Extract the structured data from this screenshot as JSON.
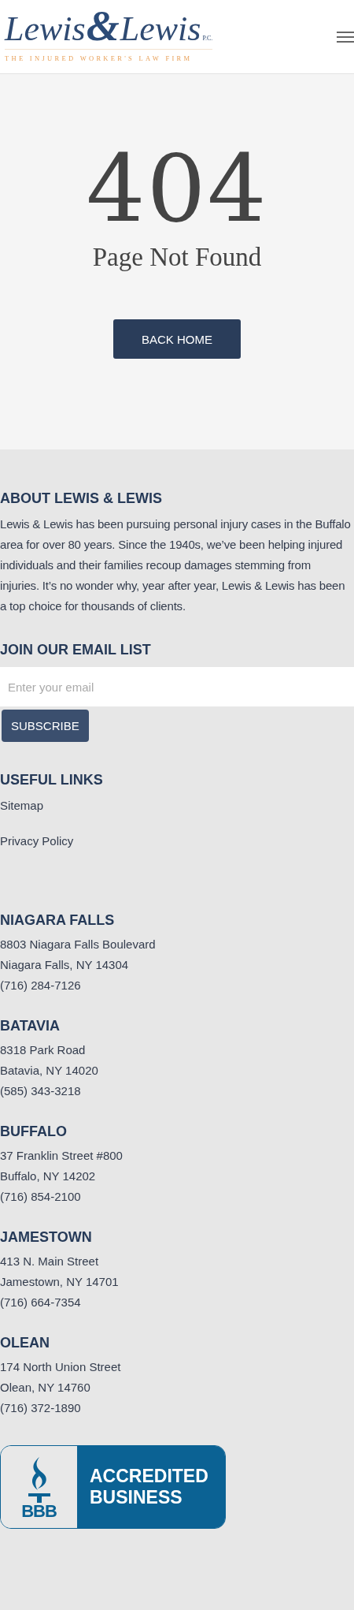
{
  "header": {
    "logo": {
      "name_first": "Lewis",
      "ampersand": "&",
      "name_second": "Lewis",
      "suffix": "P.C.",
      "tagline": "THE INJURED WORKER'S LAW FIRM"
    }
  },
  "error": {
    "code": "404",
    "title": "Page Not Found",
    "button": "BACK HOME"
  },
  "about": {
    "heading": "ABOUT LEWIS & LEWIS",
    "text": "Lewis & Lewis has been pursuing personal injury cases in the Buffalo area for over 80 years. Since the 1940s, we’ve been helping injured individuals and their families recoup damages stemming from injuries. It’s no wonder why, year after year, Lewis & Lewis has been a top choice for thousands of clients."
  },
  "newsletter": {
    "heading": "JOIN OUR EMAIL LIST",
    "placeholder": "Enter your email",
    "button": "SUBSCRIBE"
  },
  "useful_links": {
    "heading": "USEFUL LINKS",
    "links": [
      "Sitemap",
      "Privacy Policy"
    ]
  },
  "offices": [
    {
      "name": "NIAGARA FALLS",
      "lines": [
        "8803 Niagara Falls Boulevard",
        "Niagara Falls, NY 14304",
        "(716) 284-7126"
      ]
    },
    {
      "name": "BATAVIA",
      "lines": [
        "8318 Park Road",
        "Batavia, NY 14020",
        "(585) 343-3218"
      ]
    },
    {
      "name": "BUFFALO",
      "lines": [
        "37 Franklin Street #800",
        "Buffalo, NY 14202",
        "(716) 854-2100"
      ]
    },
    {
      "name": "JAMESTOWN",
      "lines": [
        "413 N. Main Street",
        "Jamestown, NY 14701",
        "(716) 664-7354"
      ]
    },
    {
      "name": "OLEAN",
      "lines": [
        "174 North Union Street",
        "Olean, NY 14760",
        "(716) 372-1890"
      ]
    }
  ],
  "badge": {
    "mark": "BBB",
    "line_1": "ACCREDITED",
    "line_2": "BUSINESS"
  }
}
